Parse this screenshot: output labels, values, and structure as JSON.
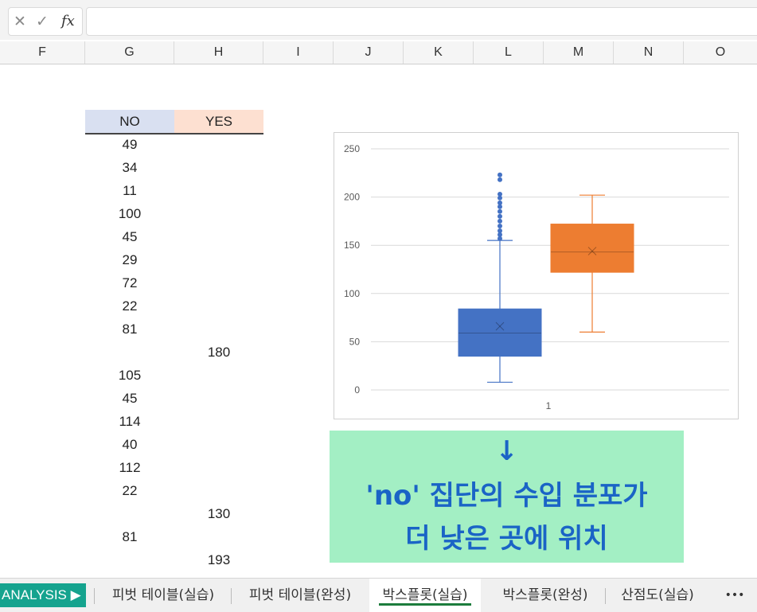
{
  "formula_bar": {
    "cancel_icon": "x-icon",
    "enter_icon": "check-icon",
    "fx_label": "fx",
    "value": ""
  },
  "columns": [
    "F",
    "G",
    "H",
    "I",
    "J",
    "K",
    "L",
    "M",
    "N",
    "O"
  ],
  "table": {
    "headers": [
      "NO",
      "YES"
    ],
    "header_colors": {
      "no": "#d9e0f1",
      "yes": "#fde0d1"
    },
    "rows": [
      {
        "no": "49",
        "yes": ""
      },
      {
        "no": "34",
        "yes": ""
      },
      {
        "no": "11",
        "yes": ""
      },
      {
        "no": "100",
        "yes": ""
      },
      {
        "no": "45",
        "yes": ""
      },
      {
        "no": "29",
        "yes": ""
      },
      {
        "no": "72",
        "yes": ""
      },
      {
        "no": "22",
        "yes": ""
      },
      {
        "no": "81",
        "yes": ""
      },
      {
        "no": "",
        "yes": "180"
      },
      {
        "no": "105",
        "yes": ""
      },
      {
        "no": "45",
        "yes": ""
      },
      {
        "no": "114",
        "yes": ""
      },
      {
        "no": "40",
        "yes": ""
      },
      {
        "no": "112",
        "yes": ""
      },
      {
        "no": "22",
        "yes": ""
      },
      {
        "no": "",
        "yes": "130"
      },
      {
        "no": "81",
        "yes": ""
      },
      {
        "no": "",
        "yes": "193"
      }
    ]
  },
  "chart_data": {
    "type": "boxplot",
    "title": "",
    "xlabel": "",
    "ylabel": "",
    "categories": [
      "1"
    ],
    "ylim": [
      0,
      250
    ],
    "yticks": [
      0,
      50,
      100,
      150,
      200,
      250
    ],
    "grid": true,
    "legend": "none",
    "series": [
      {
        "color": "#4472c4",
        "min": 8,
        "q1": 35,
        "median": 59,
        "q3": 84,
        "max": 155,
        "mean": 66,
        "outliers": [
          157,
          161,
          165,
          170,
          175,
          180,
          185,
          190,
          194,
          199,
          203,
          218,
          223
        ]
      },
      {
        "color": "#ed7d31",
        "min": 60,
        "q1": 122,
        "median": 143,
        "q3": 172,
        "max": 202,
        "mean": 144,
        "outliers": []
      }
    ]
  },
  "callout": {
    "arrow": "↓",
    "line1": "'no' 집단의 수입 분포가",
    "line2": "더 낮은 곳에 위치"
  },
  "tabs": {
    "analysis": "ANALYSIS ▶",
    "t1": "피벗 테이블(실습)",
    "t2": "피벗 테이블(완성)",
    "t3": "박스플롯(실습)",
    "t4": "박스플롯(완성)",
    "t5": "산점도(실습)",
    "more": "•••"
  }
}
